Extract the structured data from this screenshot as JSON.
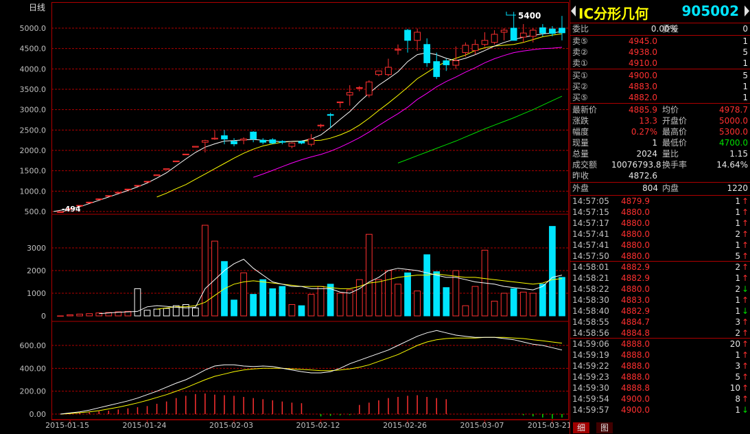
{
  "chart_panel": {
    "period_label": "日线",
    "price_axis": [
      "5000.0",
      "4500.0",
      "4000.0",
      "3500.0",
      "3000.0",
      "2500.0",
      "2000.0",
      "1500.0",
      "1000.0",
      "500.0"
    ],
    "volume_axis": [
      "3000",
      "2000",
      "1000",
      "0"
    ],
    "indicator_axis": [
      "600.00",
      "400.00",
      "200.00",
      "0.00"
    ],
    "date_labels": [
      "2015-01-15",
      "2015-01-24",
      "2015-02-03",
      "2015-02-12",
      "2015-02-26",
      "2015-03-07",
      "2015-03-21"
    ],
    "annotation_high": "5400",
    "annotation_low": "494"
  },
  "colors": {
    "up": "#ff3030",
    "down": "#00e5ff",
    "grid": "#b00000",
    "ma5": "#ffffff",
    "ma10": "#ffff00",
    "ma20": "#ff00ff",
    "ma30": "#00e000"
  },
  "chart_data": {
    "type": "candlestick",
    "price_range": [
      500,
      5000
    ],
    "candles": [
      {
        "o": 494,
        "h": 494,
        "l": 494,
        "c": 494
      },
      {
        "o": 560,
        "h": 570,
        "l": 560,
        "c": 570
      },
      {
        "o": 640,
        "h": 650,
        "l": 640,
        "c": 650
      },
      {
        "o": 720,
        "h": 730,
        "l": 720,
        "c": 730
      },
      {
        "o": 800,
        "h": 810,
        "l": 800,
        "c": 810
      },
      {
        "o": 880,
        "h": 890,
        "l": 880,
        "c": 890
      },
      {
        "o": 960,
        "h": 970,
        "l": 960,
        "c": 970
      },
      {
        "o": 1040,
        "h": 1050,
        "l": 1040,
        "c": 1050
      },
      {
        "o": 1130,
        "h": 1140,
        "l": 1130,
        "c": 1140
      },
      {
        "o": 1230,
        "h": 1240,
        "l": 1230,
        "c": 1240
      },
      {
        "o": 1380,
        "h": 1400,
        "l": 1380,
        "c": 1400
      },
      {
        "o": 1530,
        "h": 1550,
        "l": 1530,
        "c": 1550
      },
      {
        "o": 1720,
        "h": 1740,
        "l": 1720,
        "c": 1740
      },
      {
        "o": 1890,
        "h": 1910,
        "l": 1890,
        "c": 1910
      },
      {
        "o": 2080,
        "h": 2100,
        "l": 2080,
        "c": 2100
      },
      {
        "o": 2200,
        "h": 2260,
        "l": 1950,
        "c": 2240
      },
      {
        "o": 2280,
        "h": 2500,
        "l": 2260,
        "c": 2300
      },
      {
        "o": 2360,
        "h": 2500,
        "l": 2150,
        "c": 2280
      },
      {
        "o": 2220,
        "h": 2300,
        "l": 2100,
        "c": 2160
      },
      {
        "o": 2250,
        "h": 2320,
        "l": 2150,
        "c": 2280
      },
      {
        "o": 2450,
        "h": 2470,
        "l": 2200,
        "c": 2280
      },
      {
        "o": 2250,
        "h": 2300,
        "l": 2150,
        "c": 2200
      },
      {
        "o": 2260,
        "h": 2300,
        "l": 2150,
        "c": 2180
      },
      {
        "o": 2220,
        "h": 2250,
        "l": 2150,
        "c": 2200
      },
      {
        "o": 2100,
        "h": 2200,
        "l": 2050,
        "c": 2180
      },
      {
        "o": 2220,
        "h": 2240,
        "l": 2150,
        "c": 2180
      },
      {
        "o": 2150,
        "h": 2400,
        "l": 2100,
        "c": 2280
      },
      {
        "o": 2600,
        "h": 2650,
        "l": 2550,
        "c": 2620
      },
      {
        "o": 2880,
        "h": 2920,
        "l": 2550,
        "c": 2860
      },
      {
        "o": 3170,
        "h": 3200,
        "l": 3050,
        "c": 3190
      },
      {
        "o": 3360,
        "h": 3600,
        "l": 3100,
        "c": 3420
      },
      {
        "o": 3540,
        "h": 3580,
        "l": 3450,
        "c": 3540
      },
      {
        "o": 3360,
        "h": 3720,
        "l": 3300,
        "c": 3680
      },
      {
        "o": 3860,
        "h": 3920,
        "l": 3820,
        "c": 3950
      },
      {
        "o": 3860,
        "h": 4250,
        "l": 3820,
        "c": 4040
      },
      {
        "o": 4460,
        "h": 4600,
        "l": 4350,
        "c": 4480
      },
      {
        "o": 4950,
        "h": 4980,
        "l": 4400,
        "c": 4700
      },
      {
        "o": 4700,
        "h": 4990,
        "l": 4450,
        "c": 4900
      },
      {
        "o": 4600,
        "h": 4750,
        "l": 4050,
        "c": 4150
      },
      {
        "o": 4180,
        "h": 4400,
        "l": 3750,
        "c": 3810
      },
      {
        "o": 4200,
        "h": 4250,
        "l": 3950,
        "c": 4100
      },
      {
        "o": 4090,
        "h": 4550,
        "l": 4000,
        "c": 4200
      },
      {
        "o": 4400,
        "h": 4650,
        "l": 4300,
        "c": 4580
      },
      {
        "o": 4450,
        "h": 4720,
        "l": 4350,
        "c": 4600
      },
      {
        "o": 4600,
        "h": 4900,
        "l": 4550,
        "c": 4700
      },
      {
        "o": 4650,
        "h": 4950,
        "l": 4600,
        "c": 4850
      },
      {
        "o": 4900,
        "h": 5000,
        "l": 4700,
        "c": 4950
      },
      {
        "o": 5000,
        "h": 5400,
        "l": 4700,
        "c": 4700
      },
      {
        "o": 4780,
        "h": 5100,
        "l": 4650,
        "c": 4880
      },
      {
        "o": 4800,
        "h": 5000,
        "l": 4650,
        "c": 4950
      },
      {
        "o": 5010,
        "h": 5100,
        "l": 4800,
        "c": 4880
      },
      {
        "o": 4980,
        "h": 5050,
        "l": 4800,
        "c": 4870
      },
      {
        "o": 5000,
        "h": 5300,
        "l": 4700,
        "c": 4886
      }
    ],
    "ma5": [
      480,
      555,
      615,
      695,
      775,
      855,
      935,
      1015,
      1105,
      1200,
      1320,
      1450,
      1620,
      1790,
      1950,
      2080,
      2160,
      2230,
      2240,
      2260,
      2270,
      2250,
      2230,
      2210,
      2220,
      2230,
      2280,
      2380,
      2560,
      2760,
      2950,
      3190,
      3400,
      3600,
      3760,
      3930,
      4180,
      4350,
      4400,
      4350,
      4260,
      4200,
      4260,
      4350,
      4450,
      4560,
      4650,
      4720,
      4780,
      4820,
      4860,
      4880,
      4920
    ],
    "ma10": [
      null,
      null,
      null,
      null,
      null,
      null,
      null,
      null,
      null,
      null,
      855,
      950,
      1060,
      1160,
      1290,
      1420,
      1550,
      1680,
      1810,
      1930,
      2030,
      2110,
      2160,
      2200,
      2220,
      2230,
      2240,
      2250,
      2300,
      2380,
      2480,
      2620,
      2790,
      2980,
      3160,
      3350,
      3550,
      3760,
      3910,
      4060,
      4180,
      4260,
      4340,
      4450,
      4520,
      4560,
      4580,
      4600,
      4650,
      4720,
      4790,
      4830,
      4860
    ],
    "ma20": [
      null,
      null,
      null,
      null,
      null,
      null,
      null,
      null,
      null,
      null,
      null,
      null,
      null,
      null,
      null,
      null,
      null,
      null,
      null,
      null,
      1340,
      1420,
      1510,
      1600,
      1690,
      1770,
      1840,
      1900,
      1980,
      2080,
      2190,
      2310,
      2450,
      2610,
      2760,
      2900,
      3060,
      3250,
      3400,
      3560,
      3690,
      3800,
      3920,
      4030,
      4150,
      4250,
      4330,
      4400,
      4440,
      4470,
      4500,
      4510,
      4530
    ],
    "ma30": [
      null,
      null,
      null,
      null,
      null,
      null,
      null,
      null,
      null,
      null,
      null,
      null,
      null,
      null,
      null,
      null,
      null,
      null,
      null,
      null,
      null,
      null,
      null,
      null,
      null,
      null,
      null,
      null,
      null,
      null,
      null,
      null,
      null,
      null,
      null,
      1690,
      1780,
      1870,
      1960,
      2050,
      2140,
      2230,
      2330,
      2430,
      2530,
      2620,
      2710,
      2800,
      2900,
      3000,
      3110,
      3220,
      3330
    ],
    "volume": [
      0,
      50,
      80,
      100,
      130,
      150,
      180,
      200,
      1200,
      250,
      300,
      330,
      450,
      500,
      350,
      4000,
      3300,
      2400,
      700,
      1900,
      950,
      1600,
      1200,
      1300,
      500,
      450,
      950,
      1300,
      1400,
      1000,
      1150,
      1600,
      3600,
      1600,
      2000,
      1400,
      1900,
      1100,
      2700,
      1950,
      1250,
      2000,
      450,
      1300,
      2900,
      650,
      1000,
      1200,
      1050,
      1000,
      1400,
      3950,
      1700
    ],
    "vol_ma5": [
      null,
      null,
      null,
      null,
      100,
      130,
      160,
      180,
      200,
      400,
      450,
      420,
      380,
      350,
      380,
      1200,
      1600,
      2000,
      2300,
      2500,
      2100,
      1800,
      1500,
      1400,
      1300,
      1300,
      1200,
      1200,
      1200,
      1050,
      1000,
      1200,
      1500,
      1700,
      2000,
      2100,
      2050,
      2000,
      1900,
      1800,
      1700,
      1700,
      1600,
      1500,
      1450,
      1400,
      1300,
      1250,
      1200,
      1150,
      1300,
      1700,
      1800
    ],
    "vol_ma10": [
      null,
      null,
      null,
      null,
      null,
      null,
      null,
      null,
      null,
      null,
      300,
      350,
      400,
      400,
      450,
      600,
      900,
      1200,
      1400,
      1500,
      1550,
      1500,
      1450,
      1400,
      1350,
      1300,
      1300,
      1300,
      1250,
      1200,
      1200,
      1300,
      1450,
      1500,
      1600,
      1700,
      1750,
      1800,
      1800,
      1850,
      1800,
      1750,
      1700,
      1700,
      1650,
      1600,
      1550,
      1500,
      1450,
      1400,
      1450,
      1600,
      1650
    ],
    "indicator_white": [
      0,
      10,
      20,
      35,
      55,
      75,
      95,
      115,
      140,
      170,
      200,
      235,
      270,
      300,
      340,
      385,
      420,
      430,
      430,
      420,
      415,
      420,
      415,
      400,
      385,
      370,
      360,
      360,
      370,
      400,
      440,
      470,
      500,
      530,
      560,
      600,
      640,
      680,
      710,
      730,
      710,
      690,
      680,
      670,
      670,
      670,
      660,
      650,
      630,
      610,
      600,
      580,
      560
    ],
    "indicator_yellow": [
      0,
      5,
      12,
      20,
      30,
      45,
      60,
      78,
      98,
      120,
      145,
      170,
      200,
      230,
      265,
      300,
      330,
      350,
      370,
      385,
      395,
      400,
      400,
      400,
      395,
      390,
      385,
      380,
      380,
      385,
      395,
      410,
      430,
      460,
      490,
      520,
      560,
      600,
      630,
      650,
      660,
      665,
      665,
      665,
      670,
      670,
      670,
      665,
      660,
      650,
      640,
      630,
      620
    ],
    "indicator_bars": [
      0,
      5,
      10,
      15,
      25,
      30,
      40,
      50,
      60,
      70,
      90,
      110,
      140,
      160,
      175,
      180,
      170,
      165,
      160,
      150,
      140,
      130,
      120,
      110,
      100,
      95,
      0,
      -20,
      -15,
      -10,
      -8,
      80,
      100,
      120,
      140,
      150,
      160,
      165,
      150,
      140,
      130,
      0,
      0,
      0,
      0,
      0,
      0,
      0,
      -10,
      -20,
      -30,
      -40,
      -30
    ]
  },
  "quote": {
    "name": "IC分形几何",
    "code": "905002",
    "ratio_label": "委比",
    "ratio_value": "0.00%",
    "diff_label": "委差",
    "diff_value": "0",
    "asks": [
      {
        "label": "卖⑤",
        "price": "4945.0",
        "qty": "1"
      },
      {
        "label": "卖②",
        "price": "4938.0",
        "qty": "5"
      },
      {
        "label": "卖①",
        "price": "4910.0",
        "qty": "1"
      }
    ],
    "bids": [
      {
        "label": "买①",
        "price": "4900.0",
        "qty": "5"
      },
      {
        "label": "买②",
        "price": "4883.0",
        "qty": "1"
      },
      {
        "label": "买⑤",
        "price": "4882.0",
        "qty": "1"
      }
    ],
    "stats": [
      {
        "l1": "最新价",
        "v1": "4885.9",
        "c1": "red",
        "l2": "均价",
        "v2": "4978.7",
        "c2": "red"
      },
      {
        "l1": "涨跌",
        "v1": "13.3",
        "c1": "red",
        "l2": "开盘价",
        "v2": "5000.0",
        "c2": "red"
      },
      {
        "l1": "幅度",
        "v1": "0.27%",
        "c1": "red",
        "l2": "最高价",
        "v2": "5300.0",
        "c2": "red"
      },
      {
        "l1": "现量",
        "v1": "1",
        "c1": "wht",
        "l2": "最低价",
        "v2": "4700.0",
        "c2": "grn"
      },
      {
        "l1": "总量",
        "v1": "2024",
        "c1": "wht",
        "l2": "量比",
        "v2": "1.15",
        "c2": "wht"
      },
      {
        "l1": "成交额",
        "v1": "10076793.8",
        "c1": "wht",
        "l2": "换手率",
        "v2": "14.64%",
        "c2": "wht"
      }
    ],
    "prev_close_label": "昨收",
    "prev_close": "4872.6",
    "outer_label": "外盘",
    "outer_value": "804",
    "inner_label": "内盘",
    "inner_value": "1220",
    "ticks": [
      {
        "t": "14:57:05",
        "p": "4879.9",
        "v": "1",
        "d": "↑"
      },
      {
        "t": "14:57:15",
        "p": "4880.0",
        "v": "1",
        "d": "↑"
      },
      {
        "t": "14:57:17",
        "p": "4880.0",
        "v": "1",
        "d": "↑"
      },
      {
        "t": "14:57:41",
        "p": "4880.0",
        "v": "2",
        "d": "↑"
      },
      {
        "t": "14:57:41",
        "p": "4880.0",
        "v": "1",
        "d": "↑"
      },
      {
        "t": "14:57:50",
        "p": "4880.0",
        "v": "5",
        "d": "↑"
      },
      {
        "t": "14:58:01",
        "p": "4882.9",
        "v": "2",
        "d": "↑"
      },
      {
        "t": "14:58:21",
        "p": "4882.9",
        "v": "1",
        "d": "↑"
      },
      {
        "t": "14:58:22",
        "p": "4880.0",
        "v": "2",
        "d": "↓"
      },
      {
        "t": "14:58:30",
        "p": "4883.0",
        "v": "1",
        "d": "↑"
      },
      {
        "t": "14:58:40",
        "p": "4882.9",
        "v": "1",
        "d": "↓"
      },
      {
        "t": "14:58:55",
        "p": "4884.7",
        "v": "3",
        "d": "↑"
      },
      {
        "t": "14:58:56",
        "p": "4884.8",
        "v": "2",
        "d": "↑"
      },
      {
        "t": "14:59:06",
        "p": "4888.0",
        "v": "20",
        "d": "↑"
      },
      {
        "t": "14:59:19",
        "p": "4888.0",
        "v": "1",
        "d": "↑"
      },
      {
        "t": "14:59:22",
        "p": "4888.0",
        "v": "3",
        "d": "↑"
      },
      {
        "t": "14:59:23",
        "p": "4888.0",
        "v": "5",
        "d": "↑"
      },
      {
        "t": "14:59:30",
        "p": "4888.8",
        "v": "10",
        "d": "↑"
      },
      {
        "t": "14:59:54",
        "p": "4900.0",
        "v": "8",
        "d": "↑"
      },
      {
        "t": "14:59:57",
        "p": "4900.0",
        "v": "1",
        "d": "↓"
      }
    ],
    "tabs": [
      "细",
      "图"
    ]
  }
}
